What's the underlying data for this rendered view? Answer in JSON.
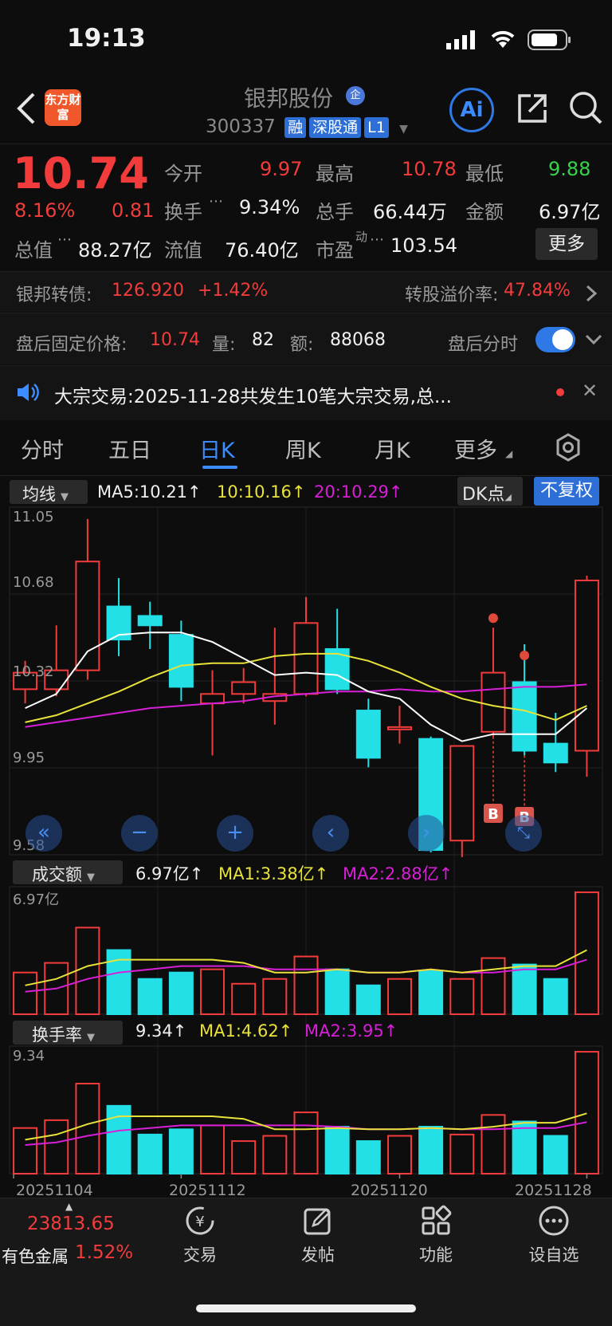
{
  "status_bar": {
    "time": "19:13"
  },
  "header": {
    "stock_name": "银邦股份",
    "stock_code": "300337",
    "tags": [
      "融",
      "深股通",
      "L1"
    ],
    "logo_text": "东方财富",
    "ai_label": "Ai"
  },
  "quote": {
    "price": "10.74",
    "pct": "8.16%",
    "change": "0.81",
    "rows": [
      [
        [
          "今开",
          "9.97",
          "red"
        ],
        [
          "最高",
          "10.78",
          "red"
        ],
        [
          "最低",
          "9.88",
          "green"
        ]
      ],
      [
        [
          "换手",
          "9.34%",
          "white"
        ],
        [
          "总手",
          "66.44万",
          "white"
        ],
        [
          "金额",
          "6.97亿",
          "white"
        ]
      ],
      [
        [
          "总值",
          "88.27亿",
          "white"
        ],
        [
          "流值",
          "76.40亿",
          "white"
        ],
        [
          "市盈",
          "103.54",
          "white"
        ]
      ]
    ],
    "more_label": "更多"
  },
  "convertible": {
    "label": "银邦转债:",
    "price": "126.920",
    "pct": "+1.42%",
    "premium_label": "转股溢价率:",
    "premium": "47.84%"
  },
  "after_hours": {
    "label": "盘后固定价格:",
    "price": "10.74",
    "vol_label": "量:",
    "vol": "82",
    "amt_label": "额:",
    "amt": "88068",
    "toggle_label": "盘后分时"
  },
  "notice": {
    "text": "大宗交易:2025-11-28共发生10笔大宗交易,总..."
  },
  "tabs": [
    "分时",
    "五日",
    "日K",
    "周K",
    "月K",
    "更多"
  ],
  "kline": {
    "indicator": "均线",
    "ma5": "MA5:10.21↑",
    "ma10": "10:10.16↑",
    "ma20": "20:10.29↑",
    "dk_label": "DK点",
    "fq_label": "不复权",
    "y_labels": [
      "11.05",
      "10.68",
      "10.32",
      "9.95",
      "9.58"
    ],
    "marker": "B"
  },
  "volume": {
    "indicator": "成交额",
    "value": "6.97亿↑",
    "ma1": "MA1:3.38亿↑",
    "ma2": "MA2:2.88亿↑",
    "y_label": "6.97亿"
  },
  "turnover": {
    "indicator": "换手率",
    "value": "9.34↑",
    "ma1": "MA1:4.62↑",
    "ma2": "MA2:3.95↑",
    "y_label": "9.34"
  },
  "x_dates": [
    "20251104",
    "20251112",
    "20251120",
    "20251128"
  ],
  "bottom_nav": {
    "index_value": "23813.65",
    "sector": "有色金属",
    "sector_pct": "1.52%",
    "items": [
      "交易",
      "发帖",
      "功能",
      "设自选"
    ]
  },
  "colors": {
    "up": "#f23c3c",
    "down": "#22e0e6",
    "ma5": "#ffffff",
    "ma10": "#e8e23a",
    "ma20": "#d81fd8",
    "accent": "#3d8cff"
  },
  "chart_data": {
    "type": "candlestick",
    "ylim": [
      9.58,
      11.05
    ],
    "series": [
      {
        "name": "",
        "values": []
      }
    ],
    "candles": [
      {
        "o": 10.28,
        "h": 10.4,
        "l": 10.22,
        "c": 10.35
      },
      {
        "o": 10.28,
        "h": 10.55,
        "l": 10.25,
        "c": 10.36
      },
      {
        "o": 10.36,
        "h": 11.0,
        "l": 10.32,
        "c": 10.82
      },
      {
        "o": 10.63,
        "h": 10.75,
        "l": 10.42,
        "c": 10.49
      },
      {
        "o": 10.59,
        "h": 10.65,
        "l": 10.45,
        "c": 10.55
      },
      {
        "o": 10.51,
        "h": 10.57,
        "l": 10.23,
        "c": 10.29
      },
      {
        "o": 10.22,
        "h": 10.36,
        "l": 10.0,
        "c": 10.26
      },
      {
        "o": 10.26,
        "h": 10.37,
        "l": 10.22,
        "c": 10.31
      },
      {
        "o": 10.23,
        "h": 10.54,
        "l": 10.13,
        "c": 10.26
      },
      {
        "o": 10.26,
        "h": 10.67,
        "l": 10.25,
        "c": 10.56
      },
      {
        "o": 10.45,
        "h": 10.62,
        "l": 10.26,
        "c": 10.28
      },
      {
        "o": 10.19,
        "h": 10.24,
        "l": 9.95,
        "c": 9.99
      },
      {
        "o": 10.11,
        "h": 10.21,
        "l": 10.05,
        "c": 10.12
      },
      {
        "o": 10.07,
        "h": 10.08,
        "l": 9.59,
        "c": 9.6
      },
      {
        "o": 9.64,
        "h": 10.02,
        "l": 9.57,
        "c": 10.04
      },
      {
        "o": 10.1,
        "h": 10.54,
        "l": 10.08,
        "c": 10.35
      },
      {
        "o": 10.31,
        "h": 10.47,
        "l": 10.0,
        "c": 10.02
      },
      {
        "o": 10.05,
        "h": 10.18,
        "l": 9.93,
        "c": 9.97
      },
      {
        "o": 10.02,
        "h": 10.76,
        "l": 9.91,
        "c": 10.74
      }
    ],
    "ma5": [
      10.2,
      10.26,
      10.44,
      10.51,
      10.52,
      10.52,
      10.48,
      10.41,
      10.34,
      10.35,
      10.34,
      10.27,
      10.24,
      10.13,
      10.06,
      10.09,
      10.09,
      10.09,
      10.2
    ],
    "ma10": [
      10.14,
      10.17,
      10.22,
      10.27,
      10.33,
      10.38,
      10.39,
      10.39,
      10.42,
      10.43,
      10.43,
      10.4,
      10.35,
      10.29,
      10.24,
      10.21,
      10.19,
      10.15,
      10.21
    ],
    "ma20": [
      10.12,
      10.14,
      10.16,
      10.18,
      10.2,
      10.21,
      10.22,
      10.23,
      10.25,
      10.26,
      10.27,
      10.27,
      10.28,
      10.27,
      10.27,
      10.28,
      10.29,
      10.29,
      10.3
    ],
    "amount": [
      1.3,
      1.6,
      2.7,
      2.0,
      1.1,
      1.3,
      1.4,
      0.95,
      1.1,
      1.8,
      1.4,
      0.9,
      1.1,
      1.35,
      1.1,
      1.75,
      1.55,
      1.1,
      3.8
    ],
    "amount_ma1": [
      0.9,
      1.1,
      1.5,
      1.7,
      1.7,
      1.7,
      1.7,
      1.6,
      1.3,
      1.3,
      1.4,
      1.3,
      1.3,
      1.4,
      1.3,
      1.4,
      1.5,
      1.5,
      2.0
    ],
    "amount_ma2": [
      0.7,
      0.8,
      1.1,
      1.3,
      1.4,
      1.5,
      1.5,
      1.5,
      1.4,
      1.4,
      1.4,
      1.3,
      1.3,
      1.4,
      1.3,
      1.3,
      1.4,
      1.4,
      1.7
    ],
    "turnover_rate": [
      3.5,
      4.1,
      6.9,
      5.2,
      3.0,
      3.4,
      3.7,
      2.5,
      2.9,
      4.7,
      3.6,
      2.5,
      2.9,
      3.6,
      3.0,
      4.5,
      4.0,
      2.9,
      9.34
    ],
    "turnover_ma1": [
      2.6,
      3.0,
      3.8,
      4.4,
      4.4,
      4.4,
      4.4,
      4.2,
      3.4,
      3.4,
      3.5,
      3.4,
      3.4,
      3.5,
      3.4,
      3.6,
      3.9,
      3.9,
      4.62
    ],
    "turnover_ma2": [
      2.2,
      2.4,
      2.9,
      3.3,
      3.5,
      3.7,
      3.7,
      3.7,
      3.7,
      3.7,
      3.6,
      3.4,
      3.4,
      3.5,
      3.4,
      3.4,
      3.5,
      3.5,
      3.95
    ]
  }
}
